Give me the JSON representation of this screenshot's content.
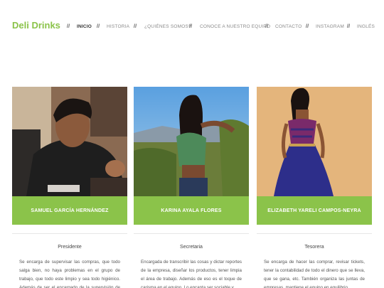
{
  "brand": {
    "name": "Deli Drinks",
    "color": "#8bc34a"
  },
  "nav": {
    "separator": "//",
    "items": [
      {
        "label": "INICIO",
        "active": true
      },
      {
        "label": "HISTORIA",
        "active": false
      },
      {
        "label": "¿QUIÉNES SOMOS?",
        "active": false
      },
      {
        "label": "CONOCE A NUESTRO EQUIPO",
        "active": false
      },
      {
        "label": "CONTACTO",
        "active": false
      },
      {
        "label": "INSTAGRAM",
        "active": false
      },
      {
        "label": "INGLÉS",
        "active": false
      }
    ]
  },
  "team": [
    {
      "name": "SAMUEL GARCÍA HERNÁNDEZ",
      "role": "Presidente",
      "description": "Se encarga de supervisar las compras, que todo salga bien, no haya problemas en el grupo de trabajo, que todo este limpio y sea todo higiénico. Además de ser el encargado de la supervisión de la"
    },
    {
      "name": "KARINA AYALA FLORES",
      "role": "Secretaria",
      "description": "Encargada de transcribir las cosas y dictar reportes de la empresa, diseñar los productos, tener limpia el área de trabajo. Además de eso es el toque de carisma en el equipo. Lo encanta ser sociable y"
    },
    {
      "name": "ELIZABETH YARELI CAMPOS-NEYRA",
      "role": "Tesorera",
      "description": "Se encarga de hacer las comprar, revisar tickets, tener la contabilidad de todo el dinero que se lleva, que se gana, etc. También organiza las juntas de empresas, mantiene el equipo en equilibrio"
    }
  ]
}
